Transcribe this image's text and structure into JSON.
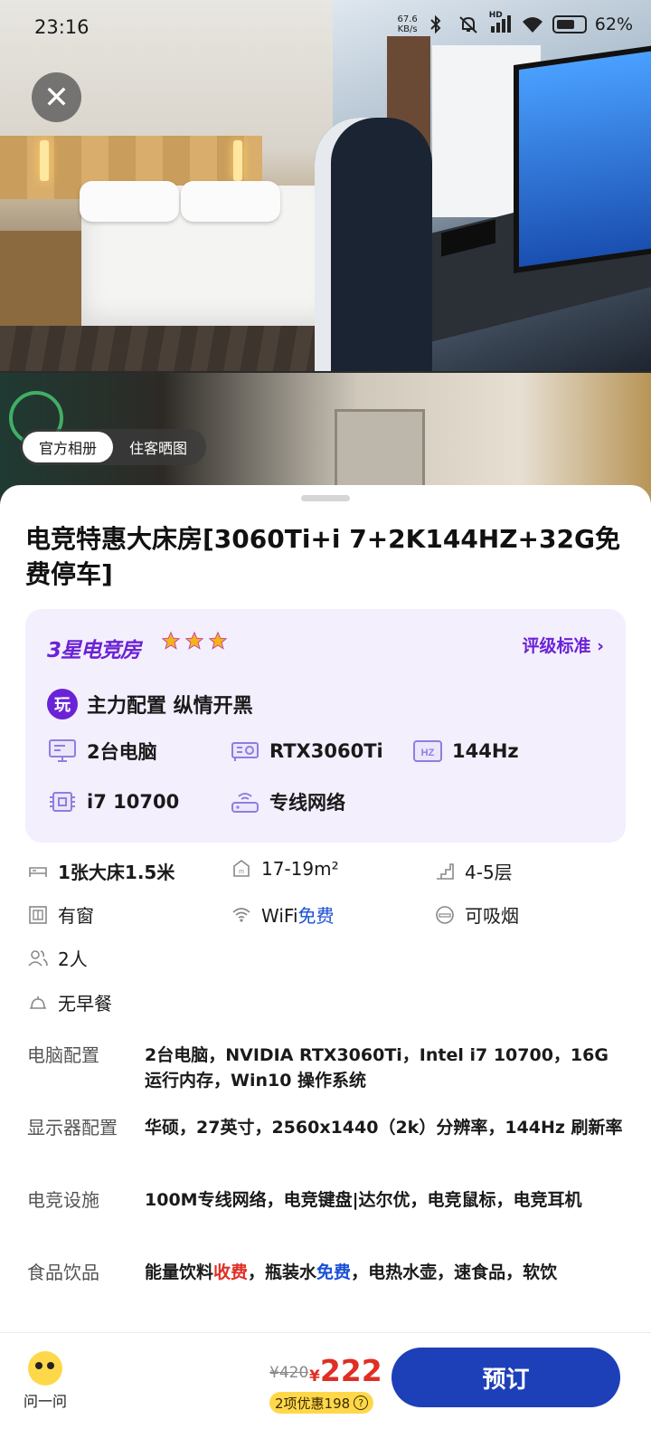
{
  "status_bar": {
    "time": "23:16",
    "net_speed_value": "67.6",
    "net_speed_unit": "KB/s",
    "network_badge": "HD",
    "battery": "62%"
  },
  "album_tabs": [
    {
      "label": "官方相册",
      "active": true
    },
    {
      "label": "住客晒图",
      "active": false
    }
  ],
  "room": {
    "title": "电竞特惠大床房[3060Ti+i 7+2K144HZ+32G免费停车]"
  },
  "esports": {
    "badge": "3星电竞房",
    "star_count": 3,
    "rating_link": "评级标准",
    "play_icon_text": "玩",
    "tagline": "主力配置 纵情开黑",
    "specs": [
      {
        "icon": "monitor-icon",
        "label": "2台电脑"
      },
      {
        "icon": "gpu-icon",
        "label": "RTX3060Ti"
      },
      {
        "icon": "hz-icon",
        "icon_text": "HZ",
        "label": "144Hz"
      },
      {
        "icon": "cpu-icon",
        "label": "i7 10700"
      },
      {
        "icon": "router-icon",
        "label": "专线网络"
      }
    ],
    "accent_color": "#6b22d6"
  },
  "facilities": {
    "bed": "1张大床1.5米",
    "area": "17-19m²",
    "floor": "4-5层",
    "window": "有窗",
    "wifi_prefix": "WiFi",
    "wifi_free": "免费",
    "smoking": "可吸烟",
    "guests": "2人",
    "breakfast": "无早餐"
  },
  "details": [
    {
      "label": "电脑配置",
      "value": "2台电脑，NVIDIA RTX3060Ti，Intel i7 10700，16G运行内存，Win10 操作系统"
    },
    {
      "label": "显示器配置",
      "value": "华硕，27英寸，2560x1440（2k）分辨率，144Hz 刷新率"
    },
    {
      "label": "电竞设施",
      "value": "100M专线网络，电竞键盘|达尔优，电竞鼠标，电竞耳机"
    },
    {
      "label": "食品饮品",
      "value_parts": [
        "能量饮料",
        "收费",
        "，瓶装水",
        "免费",
        "，电热水壶，速食品，软饮"
      ]
    }
  ],
  "bottom_bar": {
    "ask_label": "问一问",
    "original_price": "¥420",
    "currency": "¥",
    "price": "222",
    "discount": "2项优惠198",
    "discount_help": "?",
    "book_label": "预订"
  },
  "colors": {
    "price_red": "#e02e24",
    "free_blue": "#1a4fd6",
    "book_button": "#1d3fb8",
    "discount_yellow": "#ffd84a"
  }
}
